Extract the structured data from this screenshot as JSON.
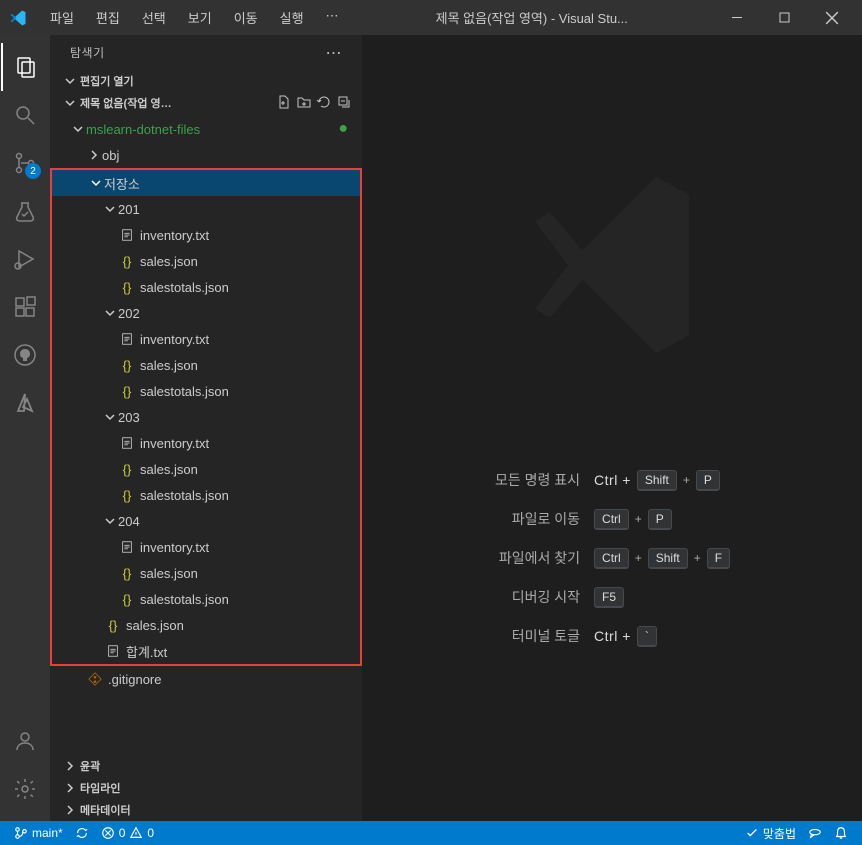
{
  "titlebar": {
    "menu": {
      "file": "파일",
      "edit": "편집",
      "selection": "선택",
      "view": "보기",
      "go": "이동",
      "run": "실행",
      "ellipsis": "⋯"
    },
    "title": "제목 없음(작업 영역) - Visual Stu..."
  },
  "activitybar": {
    "scm_badge": "2"
  },
  "sidebar": {
    "title": "탐색기",
    "sections": {
      "open_editors": "편집기 열기",
      "workspace": "제목 없음(작업 영…",
      "root_folder": "mslearn-dotnet-files",
      "obj": "obj",
      "storage": "저장소",
      "gitignore": ".gitignore",
      "outline": "윤곽",
      "timeline": "타임라인",
      "metadata": "메타데이터"
    },
    "stores": [
      {
        "name": "201",
        "files": [
          "inventory.txt",
          "sales.json",
          "salestotals.json"
        ]
      },
      {
        "name": "202",
        "files": [
          "inventory.txt",
          "sales.json",
          "salestotals.json"
        ]
      },
      {
        "name": "203",
        "files": [
          "inventory.txt",
          "sales.json",
          "salestotals.json"
        ]
      },
      {
        "name": "204",
        "files": [
          "inventory.txt",
          "sales.json",
          "salestotals.json"
        ]
      }
    ],
    "root_sales": "sales.json",
    "root_total": "합계.txt"
  },
  "welcome": {
    "rows": [
      {
        "label": "모든 명령 표시",
        "keystext": "Ctrl +",
        "keys": [
          "Shift",
          "P"
        ]
      },
      {
        "label": "파일로 이동",
        "keystext": "",
        "keys": [
          "Ctrl",
          "P"
        ]
      },
      {
        "label": "파일에서 찾기",
        "keystext": "",
        "keys": [
          "Ctrl",
          "Shift",
          "F"
        ]
      },
      {
        "label": "디버깅 시작",
        "keystext": "",
        "keys": [
          "F5"
        ]
      },
      {
        "label": "터미널 토글",
        "keystext": "Ctrl +",
        "keys": [
          "`"
        ]
      }
    ]
  },
  "statusbar": {
    "branch": "main*",
    "errors": "0",
    "warnings": "0",
    "spellcheck": "맞춤법"
  }
}
